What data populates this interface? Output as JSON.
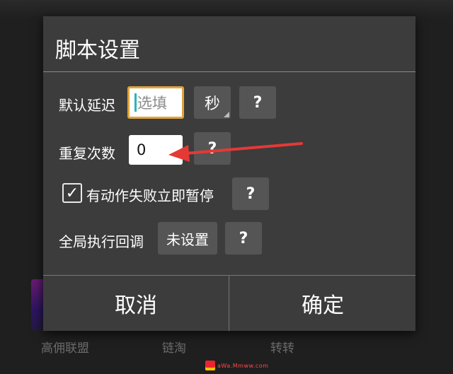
{
  "background": {
    "tabs": [
      "高佣联盟",
      "链淘",
      "转转"
    ],
    "watermark_text": "aWa.Mmww.com"
  },
  "dialog": {
    "title": "脚本设置",
    "default_delay": {
      "label": "默认延迟",
      "placeholder": "选填",
      "unit_label": "秒",
      "help_label": "?"
    },
    "repeat_count": {
      "label": "重复次数",
      "value": "0",
      "help_label": "?"
    },
    "pause_on_failure": {
      "label": "有动作失败立即暂停",
      "checked": true,
      "check_glyph": "✓",
      "help_label": "?"
    },
    "global_callback": {
      "label": "全局执行回调",
      "value_label": "未设置",
      "help_label": "?"
    },
    "cancel_label": "取消",
    "confirm_label": "确定"
  },
  "annotation": {
    "arrow_color": "#e53935"
  },
  "colors": {
    "dialog_bg": "#3c3c3c",
    "button_bg": "#555555",
    "focus_border": "#e0a43c",
    "cursor": "#23b8b4"
  }
}
